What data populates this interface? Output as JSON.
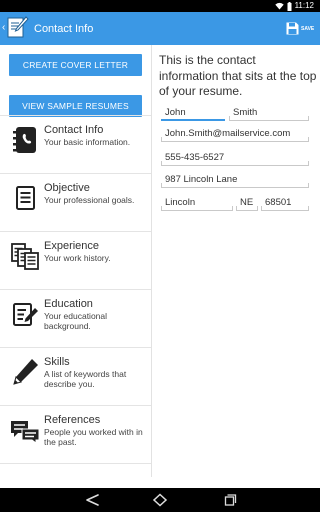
{
  "status_bar": {
    "time": "11:12"
  },
  "action_bar": {
    "title": "Contact Info",
    "save_label": "SAVE"
  },
  "left_buttons": {
    "cover_letter": "CREATE COVER LETTER",
    "sample_resumes": "VIEW SAMPLE RESUMES"
  },
  "nav": {
    "items": [
      {
        "label": "Contact Info",
        "desc": "Your basic information.",
        "icon": "address-book-icon"
      },
      {
        "label": "Objective",
        "desc": "Your professional goals.",
        "icon": "document-icon"
      },
      {
        "label": "Experience",
        "desc": "Your work history.",
        "icon": "documents-icon"
      },
      {
        "label": "Education",
        "desc": "Your educational background.",
        "icon": "notepad-pencil-icon"
      },
      {
        "label": "Skills",
        "desc": "A list of keywords that describe you.",
        "icon": "pencil-icon"
      },
      {
        "label": "References",
        "desc": "People you worked with in the past.",
        "icon": "speech-bubbles-icon"
      }
    ]
  },
  "contact": {
    "intro": "This is the contact information that sits at the top of your resume.",
    "first_name": "John",
    "last_name": "Smith",
    "email": "John.Smith@mailservice.com",
    "phone": "555-435-6527",
    "street": "987 Lincoln Lane",
    "city": "Lincoln",
    "state": "NE",
    "zip": "68501"
  },
  "colors": {
    "accent": "#3b98e5",
    "status_bar": "#000000",
    "nav_bar": "#000000"
  }
}
